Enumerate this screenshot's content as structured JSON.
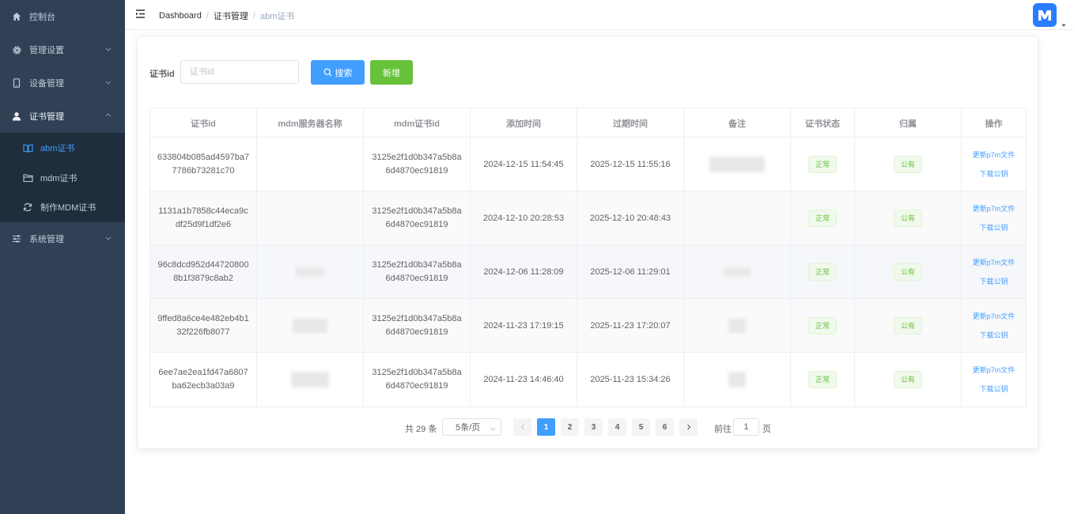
{
  "sidebar": {
    "items": [
      {
        "label": "控制台",
        "icon": "home-icon"
      },
      {
        "label": "管理设置",
        "icon": "gear-icon"
      },
      {
        "label": "设备管理",
        "icon": "phone-icon"
      },
      {
        "label": "证书管理",
        "icon": "user-icon"
      },
      {
        "label": "系统管理",
        "icon": "sliders-icon"
      }
    ],
    "sub_items": [
      {
        "label": "abm证书",
        "icon": "book-icon",
        "active": true
      },
      {
        "label": "mdm证书",
        "icon": "folder-icon"
      },
      {
        "label": "制作MDM证书",
        "icon": "refresh-icon"
      }
    ]
  },
  "navbar": {
    "breadcrumb": [
      "Dashboard",
      "证书管理",
      "abm证书"
    ]
  },
  "search": {
    "label": "证书id",
    "placeholder": "证书id",
    "search_label": "搜索",
    "add_label": "新增"
  },
  "table": {
    "columns": [
      "证书id",
      "mdm服务器名称",
      "mdm证书id",
      "添加时间",
      "过期时间",
      "备注",
      "证书状态",
      "归属",
      "操作"
    ],
    "rows": [
      {
        "cert_id": "633804b085ad4597ba77786b73281c70",
        "server": "",
        "mdm_id": "3125e2f1d0b347a5b8a6d4870ec91819",
        "added": "2024-12-15 11:54:45",
        "expires": "2025-12-15 11:55:16",
        "status": "正常",
        "owner": "公有",
        "action1": "更新p7m文件",
        "action2": "下载公钥"
      },
      {
        "cert_id": "1131a1b7858c44eca9cdf25d9f1df2e6",
        "server": "",
        "mdm_id": "3125e2f1d0b347a5b8a6d4870ec91819",
        "added": "2024-12-10 20:28:53",
        "expires": "2025-12-10 20:48:43",
        "status": "正常",
        "owner": "公有",
        "action1": "更新p7m文件",
        "action2": "下载公钥"
      },
      {
        "cert_id": "96c8dcd952d447208008b1f3879c8ab2",
        "server": "",
        "mdm_id": "3125e2f1d0b347a5b8a6d4870ec91819",
        "added": "2024-12-06 11:28:09",
        "expires": "2025-12-06 11:29:01",
        "status": "正常",
        "owner": "公有",
        "action1": "更新p7m文件",
        "action2": "下载公钥"
      },
      {
        "cert_id": "9ffed8a6ce4e482eb4b132f226fb8077",
        "server": "",
        "mdm_id": "3125e2f1d0b347a5b8a6d4870ec91819",
        "added": "2024-11-23 17:19:15",
        "expires": "2025-11-23 17:20:07",
        "status": "正常",
        "owner": "公有",
        "action1": "更新p7m文件",
        "action2": "下载公钥"
      },
      {
        "cert_id": "6ee7ae2ea1fd47a6807ba62ecb3a03a9",
        "server": "",
        "mdm_id": "3125e2f1d0b347a5b8a6d4870ec91819",
        "added": "2024-11-23 14:46:40",
        "expires": "2025-11-23 15:34:26",
        "status": "正常",
        "owner": "公有",
        "action1": "更新p7m文件",
        "action2": "下载公钥"
      }
    ]
  },
  "pagination": {
    "total_label": "共 29 条",
    "page_size": "5条/页",
    "pages": [
      "1",
      "2",
      "3",
      "4",
      "5",
      "6"
    ],
    "current": "1",
    "goto_label": "前往",
    "goto_value": "1",
    "page_unit": "页"
  },
  "colors": {
    "sidebar_bg": "#304156",
    "submenu_bg": "#1f2d3d",
    "primary": "#409eff",
    "success": "#67c23a"
  }
}
